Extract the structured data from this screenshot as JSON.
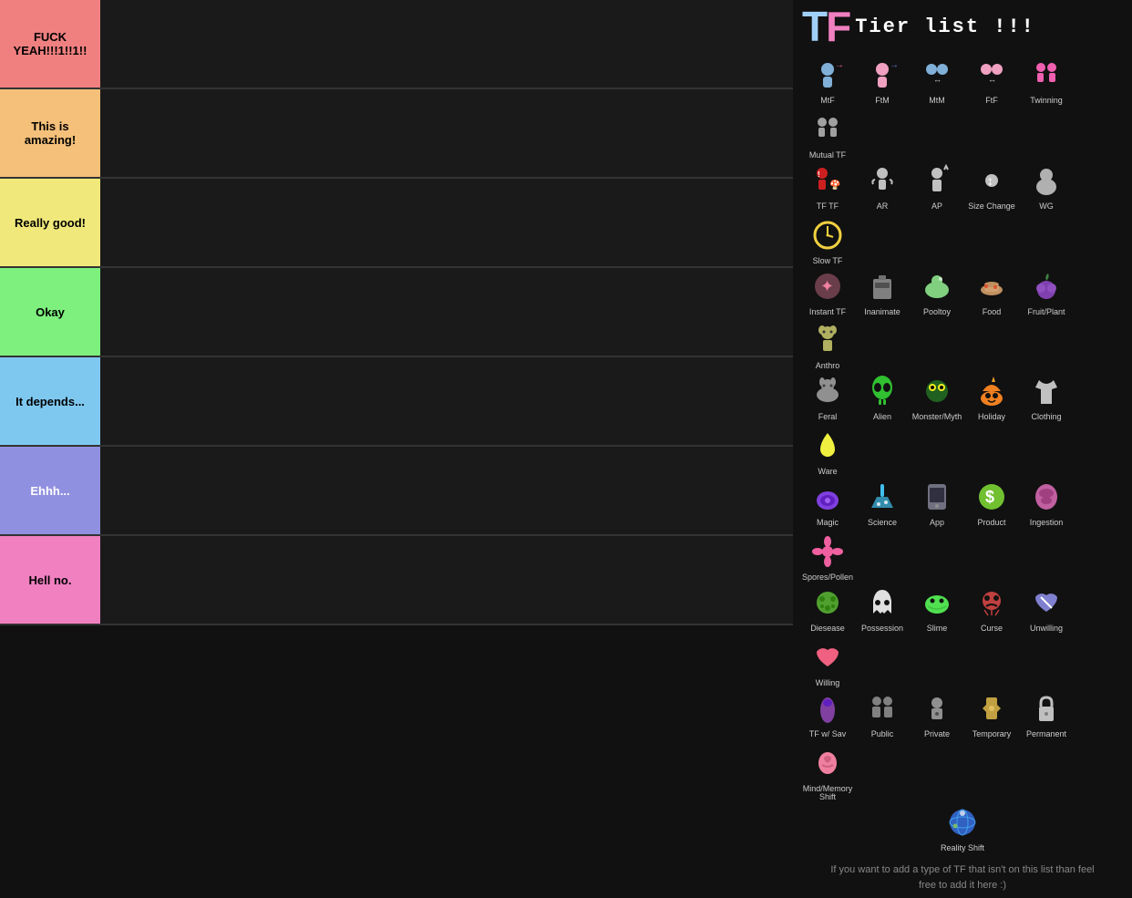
{
  "title": {
    "tf": "TF",
    "tierlist": "Tier list !!!"
  },
  "tiers": [
    {
      "id": "s",
      "label": "FUCK YEAH!!!1!!1!!",
      "color": "#f08080",
      "textColor": "#000"
    },
    {
      "id": "a",
      "label": "This is amazing!",
      "color": "#f4c07a",
      "textColor": "#000"
    },
    {
      "id": "b",
      "label": "Really good!",
      "color": "#f0e87a",
      "textColor": "#000"
    },
    {
      "id": "c",
      "label": "Okay",
      "color": "#7ef07e",
      "textColor": "#000"
    },
    {
      "id": "d",
      "label": "It depends...",
      "color": "#7ec8f0",
      "textColor": "#000"
    },
    {
      "id": "e",
      "label": "Ehhh...",
      "color": "#9090e0",
      "textColor": "#fff"
    },
    {
      "id": "f",
      "label": "Hell no.",
      "color": "#f080c0",
      "textColor": "#000"
    }
  ],
  "icons": [
    {
      "label": "MtF",
      "emoji": "🧑",
      "color": "#a0d0f8"
    },
    {
      "label": "FtM",
      "emoji": "🧑",
      "color": "#f0a0c0"
    },
    {
      "label": "MtM",
      "emoji": "🧑",
      "color": "#80c0f0"
    },
    {
      "label": "FtF",
      "emoji": "🧑",
      "color": "#f0c0e0"
    },
    {
      "label": "Twinning",
      "emoji": "👥",
      "color": "#f0a0d0"
    },
    {
      "label": "Mutual TF",
      "emoji": "👥",
      "color": "#a0a0a0"
    },
    {
      "label": "TF TF",
      "emoji": "🎮",
      "color": "#f04040"
    },
    {
      "label": "AR",
      "emoji": "👶",
      "color": "#a0a0a0"
    },
    {
      "label": "AP",
      "emoji": "👤",
      "color": "#a0a0a0"
    },
    {
      "label": "Size Change",
      "emoji": "↕️",
      "color": "#a0a0a0"
    },
    {
      "label": "WG",
      "emoji": "🧑",
      "color": "#a0a0a0"
    },
    {
      "label": "Slow TF",
      "emoji": "⏱️",
      "color": "#f0d040"
    },
    {
      "label": "Instant TF",
      "emoji": "✨",
      "color": "#f080a0"
    },
    {
      "label": "Inanimate",
      "emoji": "🪑",
      "color": "#a0a0a0"
    },
    {
      "label": "Pooltoy",
      "emoji": "🐬",
      "color": "#a0c0a0"
    },
    {
      "label": "Food",
      "emoji": "🌭",
      "color": "#f0a040"
    },
    {
      "label": "Fruit/Plant",
      "emoji": "🫐",
      "color": "#8040c0"
    },
    {
      "label": "Anthro",
      "emoji": "🦊",
      "color": "#a0a060"
    },
    {
      "label": "Feral",
      "emoji": "🐱",
      "color": "#808080"
    },
    {
      "label": "Alien",
      "emoji": "👽",
      "color": "#40c040"
    },
    {
      "label": "Monster/Myth",
      "emoji": "👾",
      "color": "#40c040"
    },
    {
      "label": "Holiday",
      "emoji": "🎃",
      "color": "#f08020"
    },
    {
      "label": "Clothing",
      "emoji": "👕",
      "color": "#c0c0c0"
    },
    {
      "label": "Ware",
      "emoji": "🌙",
      "color": "#f0f040"
    },
    {
      "label": "Magic",
      "emoji": "🔮",
      "color": "#8040e0"
    },
    {
      "label": "Science",
      "emoji": "🧪",
      "color": "#40c0f0"
    },
    {
      "label": "App",
      "emoji": "📱",
      "color": "#808090"
    },
    {
      "label": "Product",
      "emoji": "💲",
      "color": "#80c040"
    },
    {
      "label": "Ingestion",
      "emoji": "🫧",
      "color": "#c060a0"
    },
    {
      "label": "Spores/Pollen",
      "emoji": "🌸",
      "color": "#f060a0"
    },
    {
      "label": "Diesease",
      "emoji": "🦠",
      "color": "#60a040"
    },
    {
      "label": "Possession",
      "emoji": "👻",
      "color": "#d0d0d0"
    },
    {
      "label": "Slime",
      "emoji": "🟢",
      "color": "#60e060"
    },
    {
      "label": "Curse",
      "emoji": "💀",
      "color": "#c04040"
    },
    {
      "label": "Unwilling",
      "emoji": "💔",
      "color": "#8080d0"
    },
    {
      "label": "Willing",
      "emoji": "❤️",
      "color": "#f06080"
    },
    {
      "label": "TF w/ Sav",
      "emoji": "🍆",
      "color": "#8040a0"
    },
    {
      "label": "Public",
      "emoji": "👥",
      "color": "#808080"
    },
    {
      "label": "Private",
      "emoji": "🔒",
      "color": "#808080"
    },
    {
      "label": "Temporary",
      "emoji": "🔓",
      "color": "#c0a040"
    },
    {
      "label": "Permanent",
      "emoji": "🔐",
      "color": "#c0c0c0"
    },
    {
      "label": "Mind/Memory Shift",
      "emoji": "🧠",
      "color": "#f080a0"
    },
    {
      "label": "Reality Shift",
      "emoji": "🌍",
      "color": "#4080f0"
    }
  ],
  "footer": {
    "line1": "If you want to add a type of TF that isn't on this list than feel",
    "line2": "free to add it here :)"
  }
}
